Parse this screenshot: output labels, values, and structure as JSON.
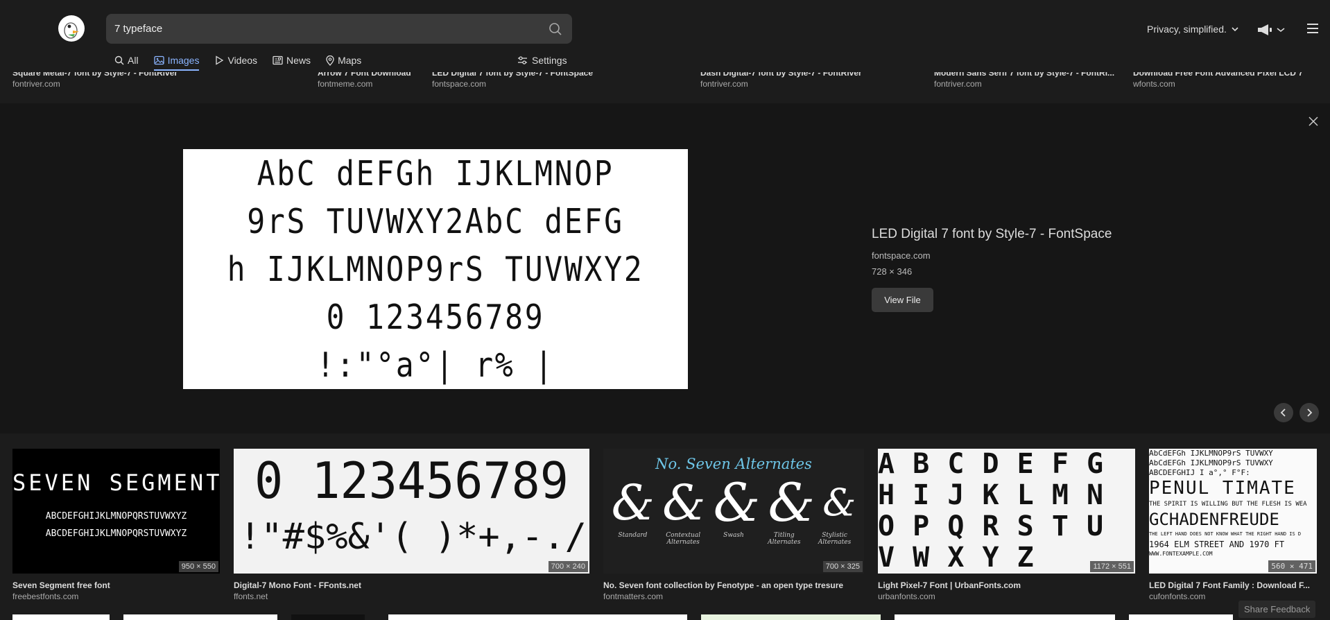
{
  "search": {
    "value": "7 typeface"
  },
  "nav": {
    "all": "All",
    "images": "Images",
    "videos": "Videos",
    "news": "News",
    "maps": "Maps",
    "settings": "Settings"
  },
  "header": {
    "privacy_label": "Privacy, simplified."
  },
  "top_strip": [
    {
      "title": "Square Metal-7 font by Style-7 - FontRiver",
      "source": "fontriver.com"
    },
    {
      "title": "Arrow 7 Font Download",
      "source": "fontmeme.com"
    },
    {
      "title": "LED Digital 7 font by Style-7 - FontSpace",
      "source": "fontspace.com"
    },
    {
      "title": "Dash Digital-7 font by Style-7 - FontRiver",
      "source": "fontriver.com"
    },
    {
      "title": "Modern Sans Serif 7 font by Style-7 - FontRi...",
      "source": "fontriver.com"
    },
    {
      "title": "Download Free Font Advanced Pixel LCD 7",
      "source": "wfonts.com"
    }
  ],
  "detail": {
    "title": "LED Digital 7 font by Style-7 - FontSpace",
    "source": "fontspace.com",
    "dimensions": "728 × 346",
    "view_file_label": "View File",
    "preview_lines": [
      "AbC dEFGh IJKLMNOP",
      "9rS TUVWXY2AbC dEFG",
      "h IJKLMNOP9rS TUVWXY2",
      "0 123456789",
      "!:\"°a°| r% |"
    ]
  },
  "results": [
    {
      "title": "Seven Segment free font",
      "source": "freebestfonts.com",
      "dimensions": "950 × 550",
      "lines": [
        "SEVEN SEGMENT",
        "ABCDEFGHIJKLMNOPQRSTUVWXYZ",
        "ABCDEFGHIJKLMNOPQRSTUVWXYZ"
      ]
    },
    {
      "title": "Digital-7 Mono Font - FFonts.net",
      "source": "ffonts.net",
      "dimensions": "700 × 240",
      "lines": [
        "0 123456789",
        "!\"#$%&'( )*+,-./"
      ]
    },
    {
      "title": "No. Seven font collection by Fenotype - an open type tresure",
      "source": "fontmatters.com",
      "dimensions": "700 × 325",
      "heading": "No. Seven Alternates",
      "glyphs": [
        "&",
        "&",
        "&",
        "&",
        "&"
      ],
      "captions": [
        "Standard",
        "Contextual Alternates",
        "Swash",
        "Titling Alternates",
        "Stylistic Alternates"
      ]
    },
    {
      "title": "Light Pixel-7 Font | UrbanFonts.com",
      "source": "urbanfonts.com",
      "dimensions": "1172 × 551",
      "lines": [
        "A B C D E F G",
        "H I J K L M N",
        "O P Q R S T U",
        "V W X Y Z"
      ]
    },
    {
      "title": "LED Digital 7 Font Family : Download F...",
      "source": "cufonfonts.com",
      "dimensions": "560 × 471",
      "lines": [
        "AbCdEFGh IJKLMNOP9rS TUVWXY",
        "AbCdEFGh IJKLMNOP9rS TUVWXY",
        "ABCDEFGHIJ I  a°,° F°F:",
        "PENUL TIMATE",
        "THE SPIRIT IS WILLING BUT THE FLESH IS WEA",
        "GCHADENFREUDE",
        "THE LEFT HAND DOES NOT KNOW WHAT THE RIGHT HAND IS D",
        "1964 ELM STREET AND 1970 FT",
        "WWW.FONTEXAMPLE.COM"
      ]
    }
  ],
  "footer": {
    "share_feedback": "Share Feedback"
  },
  "colors": {
    "accent": "#8ab4ff",
    "background": "#1c1c1c",
    "panel": "#161616"
  }
}
